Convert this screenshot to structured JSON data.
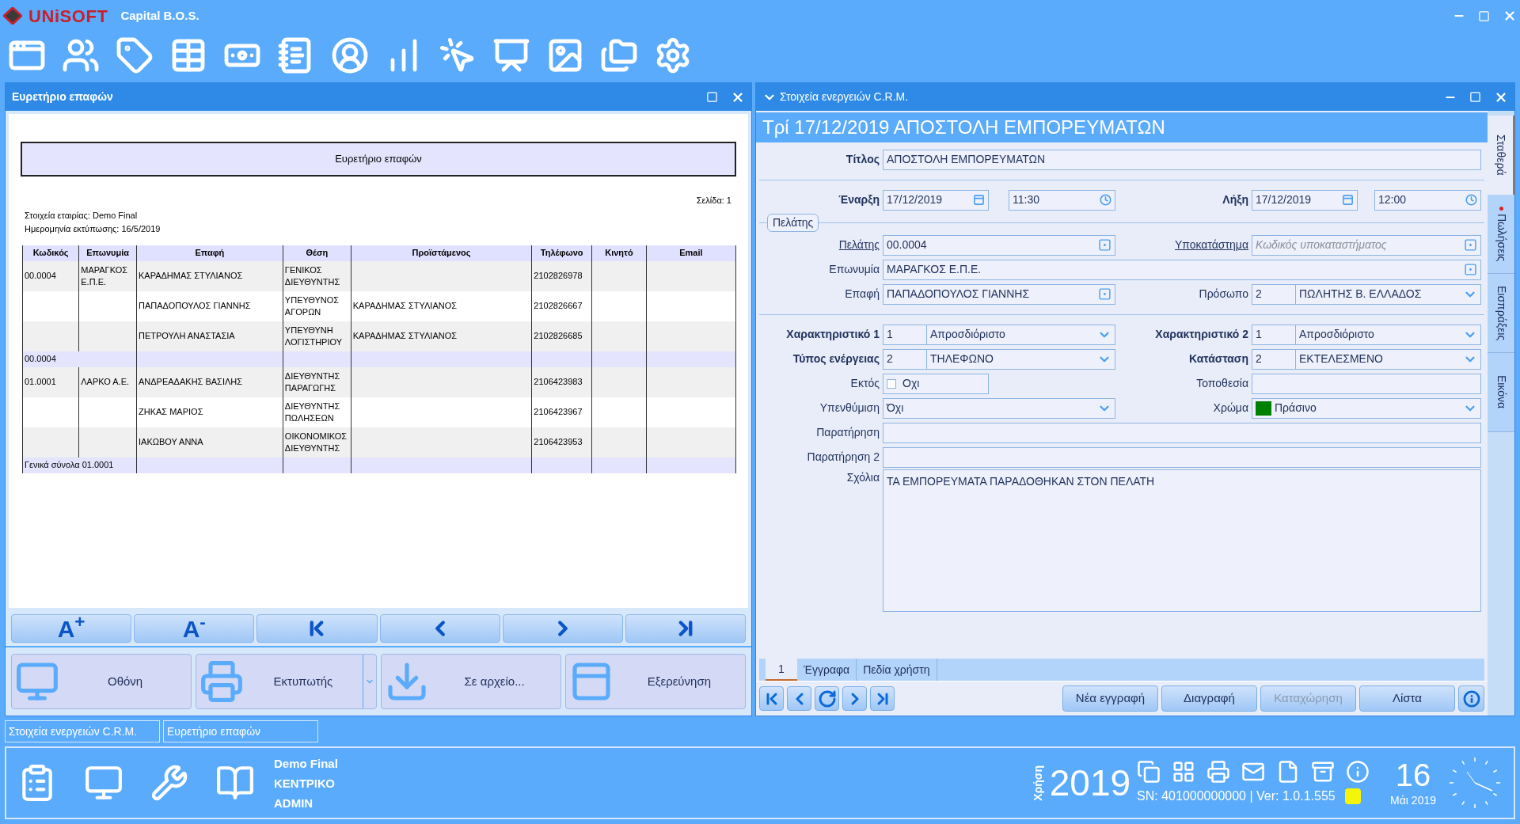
{
  "app": {
    "logo": "UNiSOFT",
    "title": "Capital B.O.S."
  },
  "left_panel": {
    "title": "Ευρετήριο επαφών",
    "report": {
      "heading": "Ευρετήριο επαφών",
      "page": "Σελίδα: 1",
      "company": "Στοιχεία εταιρίας: Demo Final",
      "print_date": "Ημερομηνία εκτύπωσης: 16/5/2019",
      "columns": [
        "Κωδικός",
        "Επωνυμία",
        "Επαφή",
        "Θέση",
        "Προϊστάμενος",
        "Τηλέφωνο",
        "Κινητό",
        "Email"
      ],
      "rows": [
        {
          "kind": "data",
          "code": "00.0004",
          "company": "ΜΑΡΑΓΚΟΣ Ε.Π.Ε.",
          "contact": "ΚΑΡΑΔΗΜΑΣ ΣΤΥΛΙΑΝΟΣ",
          "position": "ΓΕΝΙΚΟΣ ΔΙΕΥΘΥΝΤΗΣ",
          "phone": "2102826978"
        },
        {
          "kind": "data",
          "contact": "ΠΑΠΑΔΟΠΟΥΛΟΣ ΓΙΑΝΝΗΣ",
          "position": "ΥΠΕΥΘΥΝΟΣ ΑΓΟΡΩΝ",
          "manager": "ΚΑΡΑΔΗΜΑΣ ΣΤΥΛΙΑΝΟΣ",
          "phone": "2102826667"
        },
        {
          "kind": "data",
          "contact": "ΠΕΤΡΟΥΛΗ ΑΝΑΣΤΑΣΙΑ",
          "position": "ΥΠΕΥΘΥΝΗ ΛΟΓΙΣΤΗΡΙΟΥ",
          "manager": "ΚΑΡΑΔΗΜΑΣ ΣΤΥΛΙΑΝΟΣ",
          "phone": "2102826685"
        },
        {
          "kind": "total",
          "label": "00.0004"
        },
        {
          "kind": "data",
          "code": "01.0001",
          "company": "ΛΑΡΚΟ Α.Ε.",
          "contact": "ΑΝΔΡΕΑΔΑΚΗΣ ΒΑΣΙΛΗΣ",
          "position": "ΔΙΕΥΘΥΝΤΗΣ ΠΑΡΑΓΩΓΗΣ",
          "phone": "2106423983"
        },
        {
          "kind": "data",
          "contact": "ΖΗΚΑΣ ΜΑΡΙΟΣ",
          "position": "ΔΙΕΥΘΥΝΤΗΣ ΠΩΛΗΣΕΩΝ",
          "phone": "2106423967"
        },
        {
          "kind": "data",
          "contact": "ΙΑΚΩΒΟΥ ΑΝΝΑ",
          "position": "ΟΙΚΟΝΟΜΙΚΟΣ ΔΙΕΥΘΥΝΤΗΣ",
          "phone": "2106423953"
        },
        {
          "kind": "total",
          "label": "Γενικά σύνολα 01.0001"
        }
      ]
    },
    "font_buttons": [
      "A$^{+}$",
      "A$^{-}$"
    ],
    "output_buttons": [
      {
        "label": "Οθόνη",
        "kind": "screen",
        "dropdown": false
      },
      {
        "label": "Εκτυπωτής",
        "kind": "printer",
        "dropdown": true
      },
      {
        "label": "Σε αρχείο...",
        "kind": "file",
        "dropdown": false
      },
      {
        "label": "Εξερεύνηση",
        "kind": "window",
        "dropdown": false
      }
    ]
  },
  "right_panel": {
    "title": "Στοιχεία ενεργειών C.R.M.",
    "heading": "Τρί 17/12/2019 ΑΠΟΣΤΟΛΗ ΕΜΠΟΡΕΥΜΑΤΩΝ",
    "rows": [
      {
        "kind": "full",
        "field": {
          "kind": "text",
          "label": "Τίτλος",
          "bold": true,
          "link": false,
          "value": "ΑΠΟΣΤΟΛΗ ΕΜΠΟΡΕΥΜΑΤΩΝ"
        }
      },
      {
        "kind": "divider"
      },
      {
        "kind": "pair",
        "left": {
          "kind": "datetime",
          "label": "Έναρξη",
          "bold": true,
          "link": false,
          "date": "17/12/2019",
          "time": "11:30"
        },
        "right": {
          "kind": "datetime",
          "label": "Λήξη",
          "bold": true,
          "link": false,
          "date": "17/12/2019",
          "time": "12:00"
        }
      },
      {
        "kind": "group",
        "label": "Πελάτης"
      },
      {
        "kind": "pair",
        "left": {
          "kind": "lookup",
          "label": "Πελάτης",
          "bold": false,
          "link": true,
          "value": "00.0004"
        },
        "right": {
          "kind": "lookup",
          "label": "Υποκατάστημα",
          "bold": false,
          "link": true,
          "placeholder": "Κωδικός υποκαταστήματος"
        }
      },
      {
        "kind": "full",
        "field": {
          "kind": "lookup",
          "label": "Επωνυμία",
          "bold": false,
          "link": false,
          "value": "ΜΑΡΑΓΚΟΣ Ε.Π.Ε."
        }
      },
      {
        "kind": "pair",
        "left": {
          "kind": "lookup",
          "label": "Επαφή",
          "bold": false,
          "link": false,
          "value": "ΠΑΠΑΔΟΠΟΥΛΟΣ ΓΙΑΝΝΗΣ"
        },
        "right": {
          "kind": "combo",
          "label": "Πρόσωπο",
          "bold": false,
          "link": false,
          "code": "2",
          "value": "ΠΩΛΗΤΗΣ Β. ΕΛΛΑΔΟΣ"
        }
      },
      {
        "kind": "divider"
      },
      {
        "kind": "pair",
        "left": {
          "kind": "combo",
          "label": "Χαρακτηριστικό 1",
          "bold": true,
          "link": false,
          "code": "1",
          "value": "Απροσδιόριστο"
        },
        "right": {
          "kind": "combo",
          "label": "Χαρακτηριστικό 2",
          "bold": true,
          "link": false,
          "code": "1",
          "value": "Απροσδιόριστο"
        }
      },
      {
        "kind": "pair",
        "left": {
          "kind": "combo",
          "label": "Τύπος ενέργειας",
          "bold": true,
          "link": false,
          "code": "2",
          "value": "ΤΗΛΕΦΩΝΟ"
        },
        "right": {
          "kind": "combo",
          "label": "Κατάσταση",
          "bold": true,
          "link": false,
          "code": "2",
          "value": "ΕΚΤΕΛΕΣΜΕΝΟ"
        }
      },
      {
        "kind": "pair",
        "left": {
          "kind": "check",
          "label": "Εκτός",
          "bold": false,
          "link": false,
          "checked": false,
          "value": "Οχι"
        },
        "right": {
          "kind": "text",
          "label": "Τοποθεσία",
          "bold": false,
          "link": false
        }
      },
      {
        "kind": "pair",
        "left": {
          "kind": "combo",
          "label": "Υπενθύμιση",
          "bold": false,
          "link": false,
          "value": "Όχι"
        },
        "right": {
          "kind": "combo",
          "label": "Χρώμα",
          "bold": false,
          "link": false,
          "color": "#008000",
          "value": "Πράσινο"
        }
      },
      {
        "kind": "full",
        "field": {
          "kind": "text",
          "label": "Παρατήρηση",
          "bold": false,
          "link": false
        }
      },
      {
        "kind": "full",
        "field": {
          "kind": "text",
          "label": "Παρατήρηση 2",
          "bold": false,
          "link": false
        }
      },
      {
        "kind": "full",
        "field": {
          "kind": "memo",
          "label": "Σχόλια",
          "bold": false,
          "link": false,
          "value": "ΤΑ ΕΜΠΟΡΕΥΜΑΤΑ ΠΑΡΑΔΟΘΗΚΑΝ ΣΤΟΝ ΠΕΛΑΤΗ"
        }
      }
    ],
    "side_tabs": [
      {
        "label": "Σταθερά",
        "selected": true,
        "marked": false
      },
      {
        "label": "Πωλήσεις",
        "selected": false,
        "marked": true
      },
      {
        "label": "Εισπράξεις",
        "selected": false,
        "marked": false
      },
      {
        "label": "Εικόνα",
        "selected": false,
        "marked": false
      }
    ],
    "bottom_tabs": [
      {
        "label": "1",
        "selected": true
      },
      {
        "label": "Έγγραφα",
        "selected": false
      },
      {
        "label": "Πεδία χρήστη",
        "selected": false
      }
    ],
    "buttons": [
      {
        "label": "Νέα εγγραφή",
        "disabled": false
      },
      {
        "label": "Διαγραφή",
        "disabled": false
      },
      {
        "label": "Καταχώρηση",
        "disabled": true
      },
      {
        "label": "Λίστα",
        "disabled": false
      }
    ]
  },
  "taskbar": [
    {
      "label": "Στοιχεία ενεργειών C.R.M."
    },
    {
      "label": "Ευρετήριο επαφών"
    }
  ],
  "status": {
    "company": "Demo Final",
    "branch": "ΚΕΝΤΡΙΚΟ",
    "user": "ADMIN",
    "fiscal_label": "Χρήση",
    "year": "2019",
    "serial": "SN: 401000000000 | Ver: 1.0.1.555",
    "day": "16",
    "month": "Μάι 2019"
  }
}
